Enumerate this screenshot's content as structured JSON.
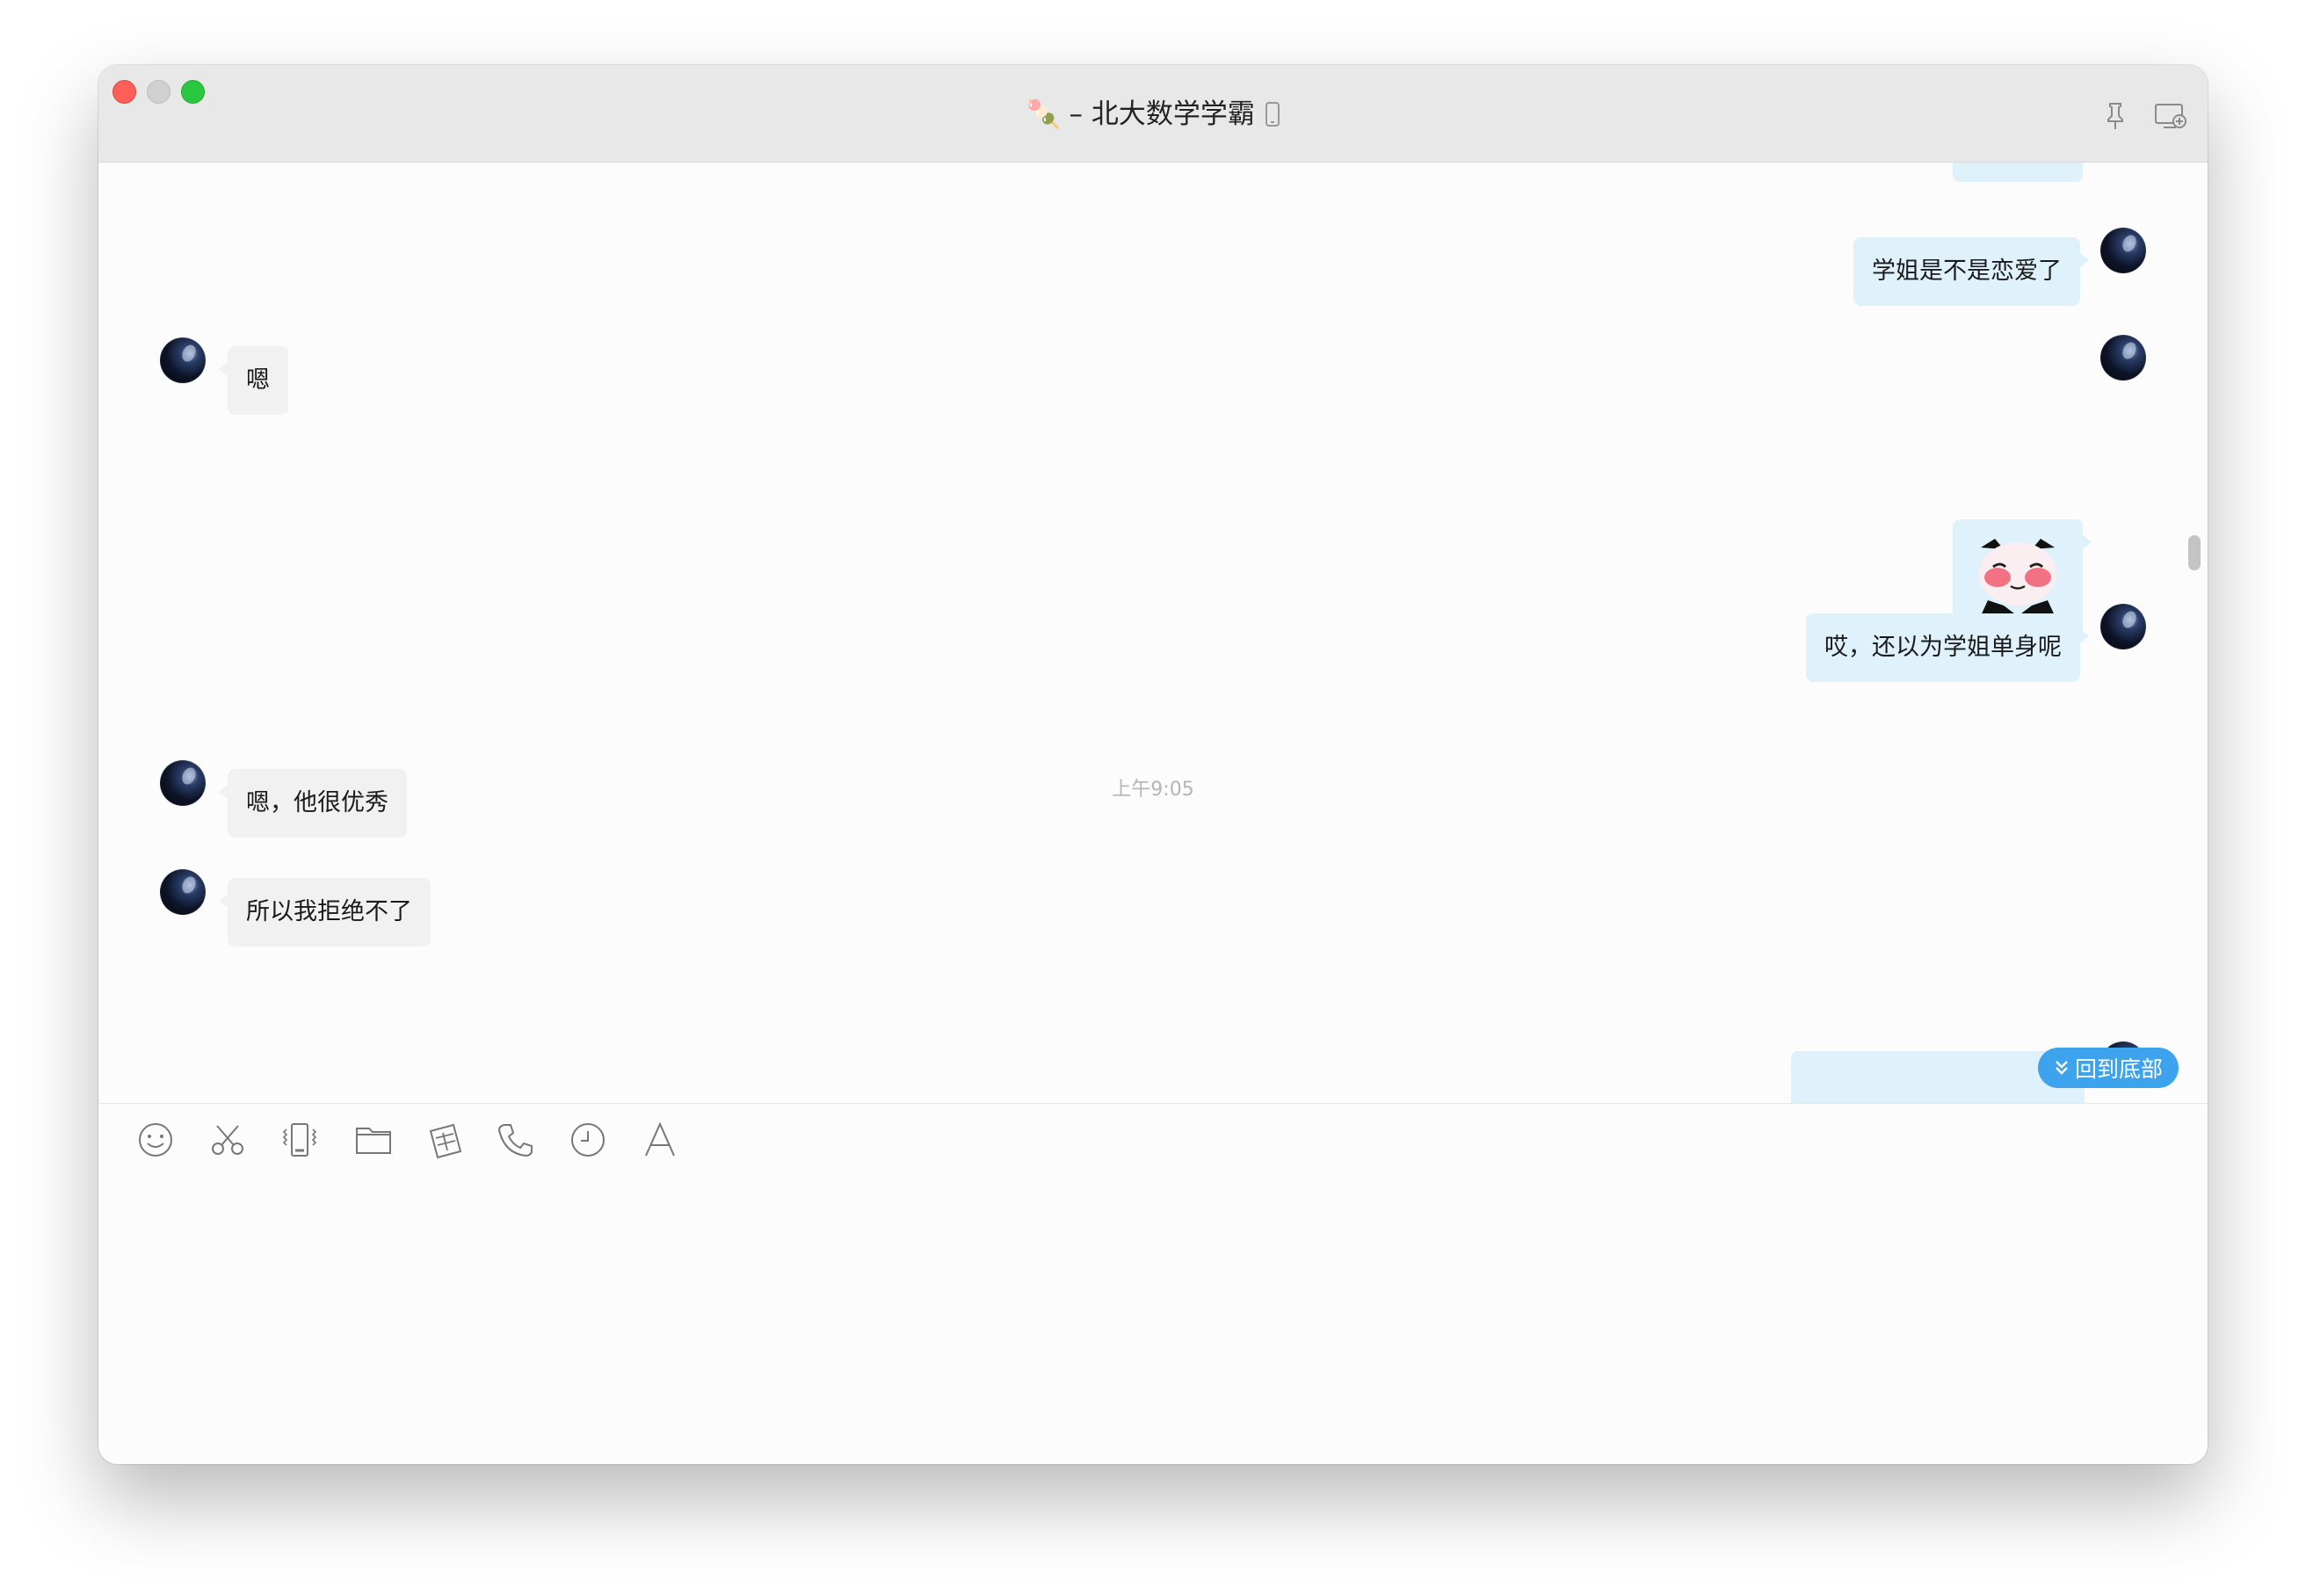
{
  "window": {
    "title": "🍡 – 北大数学学霸"
  },
  "messages": [
    {
      "id": "m1",
      "direction": "out",
      "text": "学姐是不是恋爱了"
    },
    {
      "id": "m2",
      "direction": "in",
      "text": "嗯"
    },
    {
      "id": "m3",
      "direction": "out",
      "type": "sticker",
      "sticker": "panda-blush-sticker"
    },
    {
      "id": "m4",
      "direction": "out",
      "text": "哎，还以为学姐单身呢"
    },
    {
      "id": "m5",
      "direction": "in",
      "text": "嗯，他很优秀"
    },
    {
      "id": "m6",
      "direction": "in",
      "text": "所以我拒绝不了"
    }
  ],
  "timestamp": "上午9:05",
  "back_to_bottom": "回到底部",
  "toolbar": {
    "icons": [
      "emoji-icon",
      "scissors-icon",
      "shake-icon",
      "folder-icon",
      "screenshot-icon",
      "phone-icon",
      "clock-icon",
      "font-icon"
    ]
  },
  "colors": {
    "outgoing_bubble": "#dff1fb",
    "incoming_bubble": "#f1f1f1",
    "accent": "#3da3ec"
  }
}
